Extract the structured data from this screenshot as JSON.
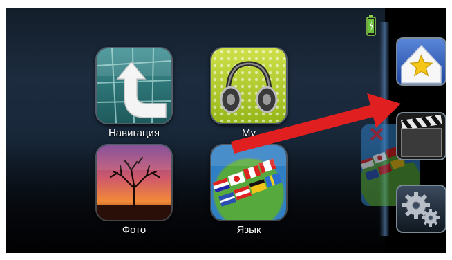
{
  "apps": [
    {
      "id": "navigation",
      "label": "Навигация",
      "icon": "navigation-arrow-icon"
    },
    {
      "id": "music",
      "label": "Му",
      "icon": "headphones-icon"
    },
    {
      "id": "photo",
      "label": "Фото",
      "icon": "tree-sunset-icon"
    },
    {
      "id": "language",
      "label": "Язык",
      "icon": "flags-globe-icon"
    }
  ],
  "sidebar": {
    "buttons": [
      {
        "id": "favorites",
        "icon": "star-icon"
      },
      {
        "id": "video",
        "icon": "clapperboard-icon"
      },
      {
        "id": "settings",
        "icon": "gears-icon"
      }
    ]
  },
  "status": {
    "battery_icon": "battery-charging-icon"
  },
  "annotation": {
    "arrow_color": "#e02020",
    "icon": "red-arrow-annotation"
  },
  "colors": {
    "background": "#000000",
    "sidebar_button_border": "#7e8b99",
    "label": "#ffffff"
  }
}
